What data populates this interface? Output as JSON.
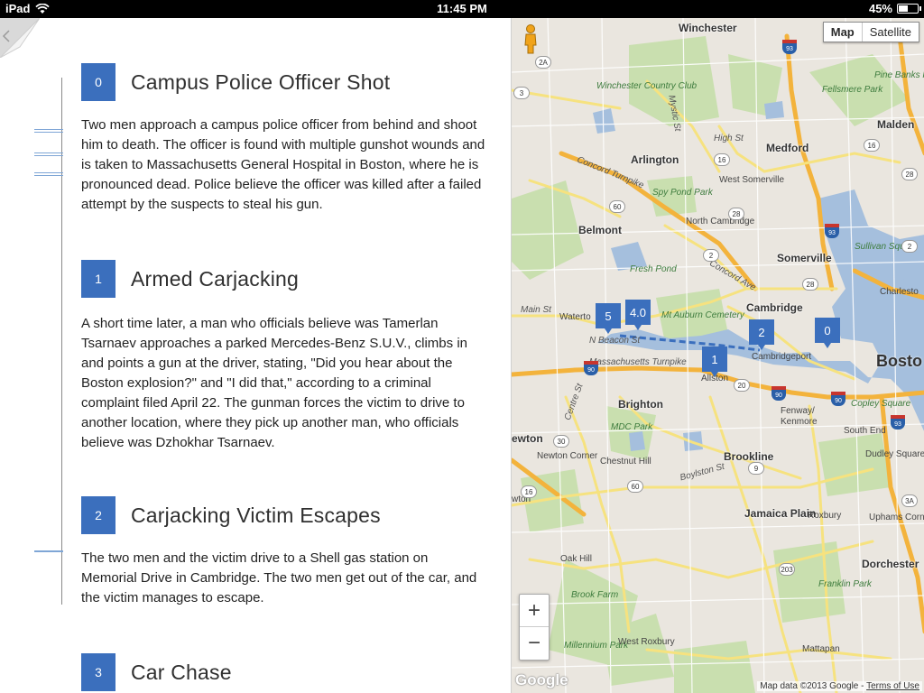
{
  "status_bar": {
    "device": "iPad",
    "time": "11:45 PM",
    "battery": "45%",
    "battery_level": 0.45
  },
  "events": [
    {
      "number": "0",
      "title": "Campus Police Officer Shot",
      "body": "Two men approach a campus police officer from behind and shoot him to death. The officer is found with multiple gunshot wounds and is taken to Massachusetts General Hospital in Boston, where he is pronounced dead. Police believe the officer was killed after a failed attempt by the suspects to steal his gun."
    },
    {
      "number": "1",
      "title": "Armed Carjacking",
      "body": "A short time later, a man who officials believe was Tamerlan Tsarnaev approaches a parked Mercedes-Benz S.U.V., climbs in and points a gun at the driver, stating, \"Did you hear about the Boston explosion?\" and \"I did that,\" according to a criminal complaint filed April 22. The gunman forces the victim to drive to another location, where they pick up another man, who officials believe was Dzhokhar Tsarnaev."
    },
    {
      "number": "2",
      "title": "Carjacking Victim Escapes",
      "body": "The two men and the victim drive to a Shell gas station on Memorial Drive in Cambridge. The two men get out of the car, and the victim manages to escape."
    },
    {
      "number": "3",
      "title": "Car Chase",
      "body": ""
    }
  ],
  "map": {
    "type_buttons": {
      "map": "Map",
      "satellite": "Satellite"
    },
    "zoom_in": "+",
    "zoom_out": "−",
    "logo": "Google",
    "attribution": "Map data ©2013 Google",
    "separator": "-",
    "terms": "Terms of Use",
    "markers": [
      "5",
      "4.0",
      "1",
      "2",
      "0"
    ],
    "labels": {
      "winchester": "Winchester",
      "winchester_cc": "Winchester Country Club",
      "arlington": "Arlington",
      "medford": "Medford",
      "malden": "Malden",
      "fellsmere": "Fellsmere Park",
      "pine_banks": "Pine Banks Park",
      "spy_pond": "Spy Pond Park",
      "west_somerville": "West Somerville",
      "north_cambridge": "North Cambridge",
      "belmont": "Belmont",
      "somerville": "Somerville",
      "sullivan": "Sullivan Square",
      "charlestown": "Charlesto",
      "fresh_pond": "Fresh Pond",
      "mt_auburn": "Mt Auburn Cemetery",
      "cambridge": "Cambridge",
      "watertown": "Waterto",
      "cambridgeport": "Cambridgeport",
      "boston": "Bosto",
      "allston": "Allston",
      "brighton": "Brighton",
      "fenway": "Fenway/ Kenmore",
      "mdc_park": "MDC Park",
      "copley": "Copley Square",
      "south_end": "South End",
      "newton": "ewton",
      "newton_corner": "Newton Corner",
      "chestnut_hill": "Chestnut Hill",
      "brookline": "Brookline",
      "dudley": "Dudley Square",
      "oak_hill": "Oak Hill",
      "jamaica_plain": "Jamaica Plain",
      "roxbury": "Roxbury",
      "uphams": "Uphams Corne Hills",
      "dorchester": "Dorchester",
      "brook_farm": "Brook Farm",
      "franklin_park": "Franklin Park",
      "millennium_park": "Millennium Park",
      "west_roxbury": "West Roxbury",
      "mattapan": "Mattapan",
      "concord_turnpike": "Concord Turnpike",
      "mass_turnpike": "Massachusetts Turnpike",
      "main_st": "Main St",
      "concord_ave": "Concord Ave",
      "high_st": "High St",
      "mystic_st": "Mystic St",
      "boylston_st": "Boylston St",
      "centre_st": "Centre St",
      "n_beacon": "N Beacon St",
      "wton": "wton"
    },
    "shields": [
      "93",
      "2A",
      "3",
      "16",
      "60",
      "2",
      "28",
      "38",
      "20",
      "9",
      "30",
      "203",
      "2",
      "16",
      "28",
      "93",
      "3A",
      "16",
      "60",
      "20",
      "9",
      "203"
    ],
    "interstates": [
      "93",
      "93",
      "90",
      "90",
      "90",
      "93"
    ]
  }
}
